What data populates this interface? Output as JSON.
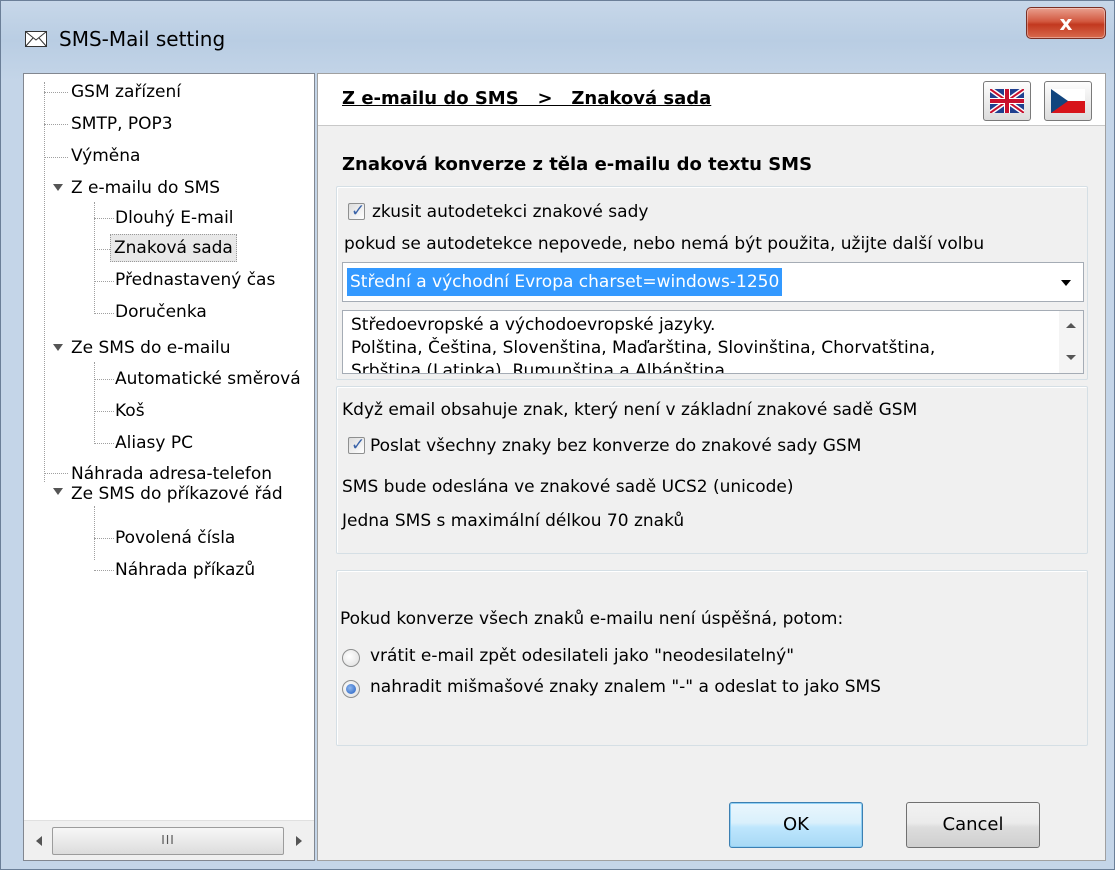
{
  "window": {
    "title": "SMS-Mail setting",
    "close_label": "x"
  },
  "tree": {
    "items": [
      {
        "label": "GSM zařízení"
      },
      {
        "label": "SMTP, POP3"
      },
      {
        "label": "Výměna"
      },
      {
        "label": "Z e-mailu do SMS"
      },
      {
        "label": "Dlouhý E-mail"
      },
      {
        "label": "Znaková sada"
      },
      {
        "label": "Přednastavený čas"
      },
      {
        "label": "Doručenka"
      },
      {
        "label": "Ze SMS do e-mailu"
      },
      {
        "label": "Automatické směrová"
      },
      {
        "label": "Koš"
      },
      {
        "label": "Aliasy PC"
      },
      {
        "label": "Náhrada adresa-telefon"
      },
      {
        "label": "Ze SMS do příkazové řád"
      },
      {
        "label": "Povolená čísla"
      },
      {
        "label": "Náhrada příkazů"
      }
    ],
    "selected": "Znaková sada",
    "scroll_thumb_grip": "III"
  },
  "header": {
    "breadcrumb": "Z e-mailu do SMS   >   Znaková sada"
  },
  "section": {
    "title": "Znaková konverze z těla e-mailu do textu SMS"
  },
  "charset_group": {
    "autodetect_label": "zkusit autodetekci znakové sady",
    "autodetect_checked": true,
    "fallback_text": "pokud se autodetekce nepovede, nebo nemá být použita, užijte další volbu",
    "charset_value": "Střední a východní Evropa  charset=windows-1250",
    "description_line1": "Středoevropské a východoevropské jazyky.",
    "description_line2": "Polština, Čeština, Slovenština, Maďarština, Slovinština, Chorvatština,",
    "description_line3": "Srbština (Latinka), Rumunština a Albánština"
  },
  "gsm_group": {
    "info_text": "Když email obsahuje znak, který není v základní znakové sadě GSM",
    "send_all_label": "Poslat všechny znaky bez konverze do znakové sady GSM",
    "send_all_checked": true,
    "ucs2_text": "SMS bude odeslána ve znakové sadě UCS2 (unicode)",
    "length_text": "Jedna SMS s maximální délkou 70 znaků"
  },
  "failure_group": {
    "prompt": "Pokud konverze všech znaků e-mailu není úspěšná, potom:",
    "option1": "vrátit e-mail zpět odesilateli jako \"neodesilatelný\"",
    "option2": "nahradit mišmašové znaky znalem \"-\" a odeslat to jako SMS",
    "selected_option": 2
  },
  "buttons": {
    "ok": "OK",
    "cancel": "Cancel"
  },
  "icons": {
    "title_icon": "envelope-icon",
    "flag_en": "uk-flag-icon",
    "flag_cz": "czech-flag-icon"
  },
  "colors": {
    "selection": "#3399ff",
    "close_button": "#c2381f",
    "default_button": "#bee6fd"
  }
}
